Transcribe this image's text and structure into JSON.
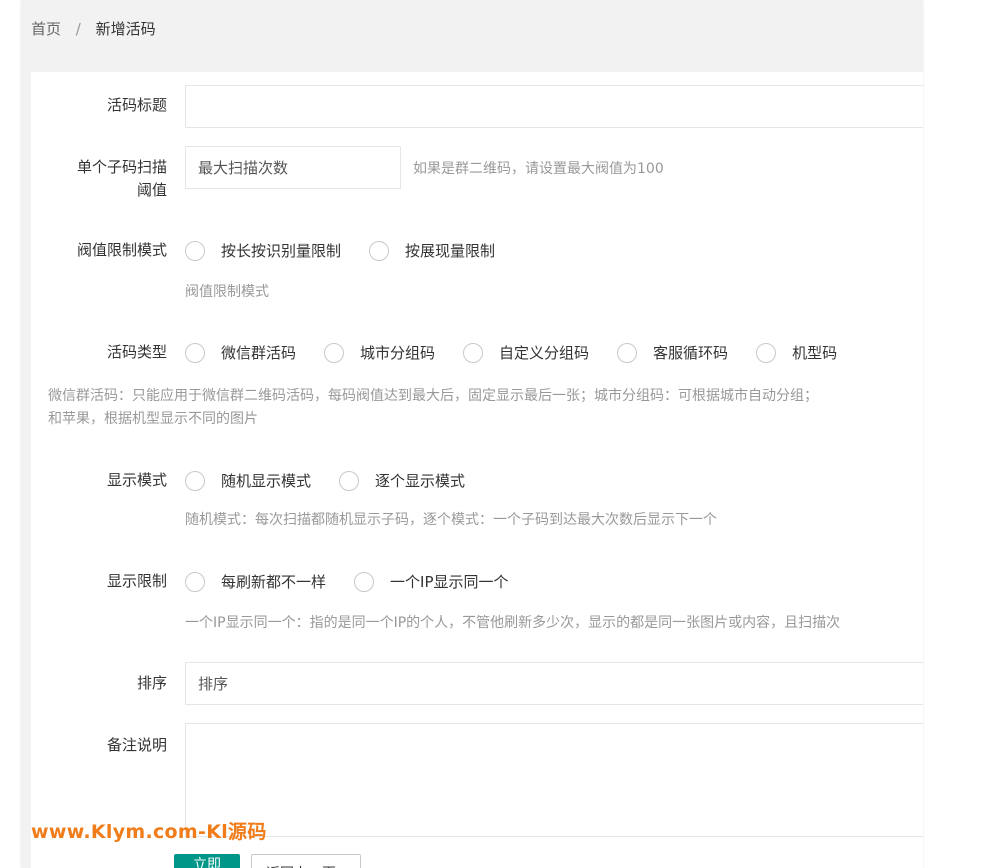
{
  "breadcrumb": {
    "home": "首页",
    "separator": "/",
    "current": "新增活码"
  },
  "form": {
    "title": {
      "label": "活码标题",
      "value": "",
      "placeholder": ""
    },
    "threshold": {
      "label_line1": "单个子码扫描",
      "label_line2": "阈值",
      "value": "",
      "placeholder": "最大扫描次数",
      "aux": "如果是群二维码，请设置最大阀值为100"
    },
    "threshold_mode": {
      "label": "阀值限制模式",
      "options": [
        "按长按识别量限制",
        "按展现量限制"
      ],
      "note": "阀值限制模式"
    },
    "code_type": {
      "label": "活码类型",
      "options": [
        "微信群活码",
        "城市分组码",
        "自定义分组码",
        "客服循环码",
        "机型码"
      ],
      "note_line1": "微信群活码：只能应用于微信群二维码活码，每码阀值达到最大后，固定显示最后一张；城市分组码：可根据城市自动分组；",
      "note_line2": "和苹果，根据机型显示不同的图片"
    },
    "display_mode": {
      "label": "显示模式",
      "options": [
        "随机显示模式",
        "逐个显示模式"
      ],
      "note": "随机模式：每次扫描都随机显示子码，逐个模式：一个子码到达最大次数后显示下一个"
    },
    "display_limit": {
      "label": "显示限制",
      "options": [
        "每刷新都不一样",
        "一个IP显示同一个"
      ],
      "note": "一个IP显示同一个：指的是同一个IP的个人，不管他刷新多少次，显示的都是同一张图片或内容，且扫描次"
    },
    "sort": {
      "label": "排序",
      "value": "",
      "placeholder": "排序"
    },
    "remark": {
      "label": "备注说明",
      "value": ""
    }
  },
  "buttons": {
    "submit": "立即提交",
    "back": "返回上一页"
  },
  "watermark": "www.Klym.com-Kl源码",
  "colors": {
    "primary": "#009688",
    "watermark": "#f07c1a"
  }
}
